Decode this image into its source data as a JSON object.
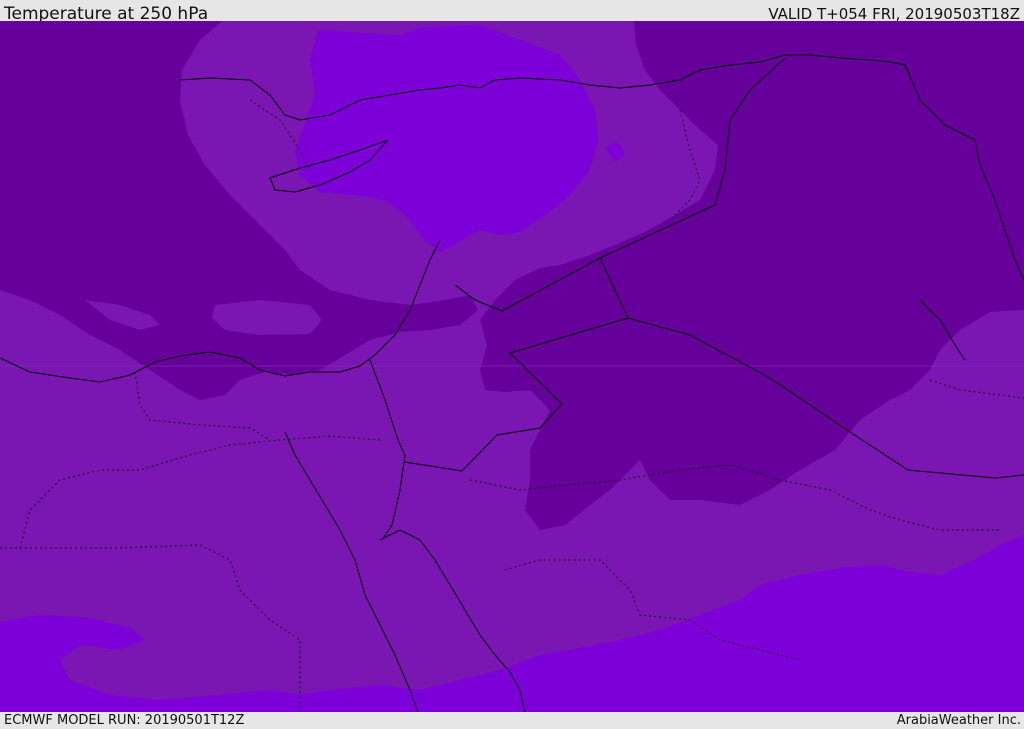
{
  "header": {
    "title": "Temperature at 250 hPa",
    "valid": "VALID T+054 FRI, 20190503T18Z"
  },
  "footer": {
    "model_run": "ECMWF MODEL RUN: 20190501T12Z",
    "credit": "ArabiaWeather Inc."
  },
  "colors": {
    "cold_band": "#66009a",
    "mid_band": "#7a16b1",
    "warm_band": "#7d00d9",
    "warmest_band": "#8a12ea",
    "borders": "#000000",
    "bars": "#e6e6e6"
  }
}
